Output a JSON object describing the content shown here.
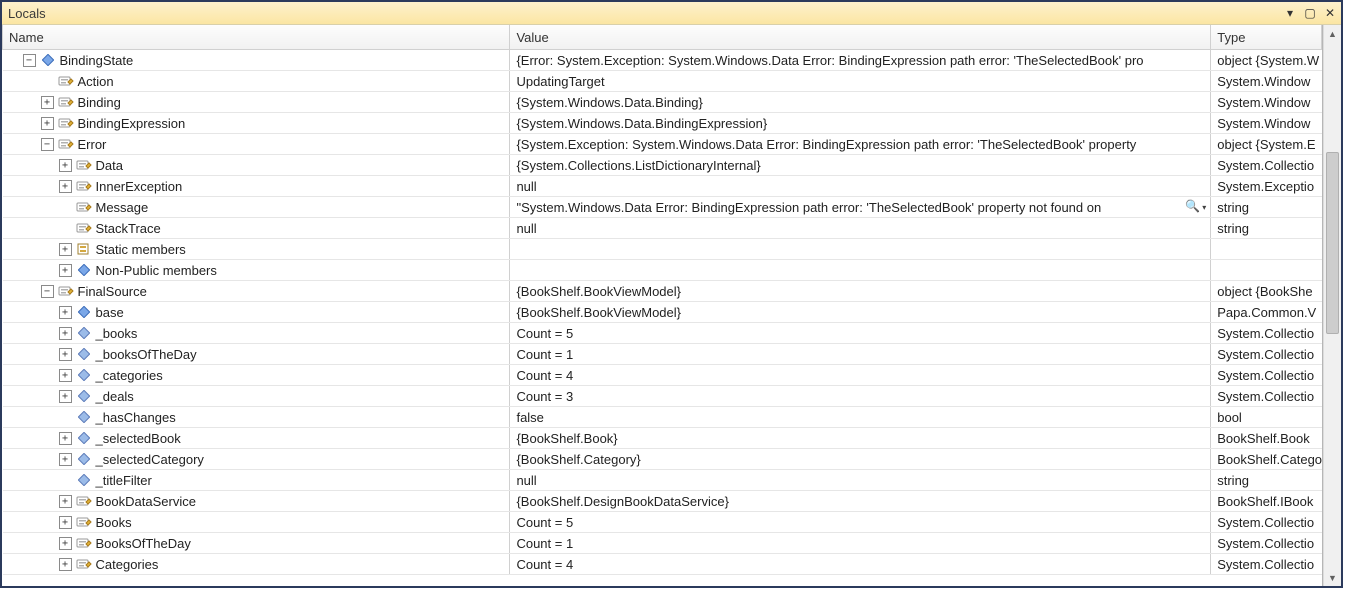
{
  "window": {
    "title": "Locals"
  },
  "columns": {
    "name": "Name",
    "value": "Value",
    "type": "Type"
  },
  "widths": {
    "name": 504,
    "value": 696,
    "type": 110
  },
  "rows": [
    {
      "depth": 0,
      "expander": "minus",
      "icon": "diamond-blue",
      "name": "BindingState",
      "value": "{Error: System.Exception: System.Windows.Data Error: BindingExpression path error: 'TheSelectedBook' pro",
      "type": "object {System.W"
    },
    {
      "depth": 1,
      "expander": "none",
      "icon": "prop",
      "name": "Action",
      "value": "UpdatingTarget",
      "type": "System.Window"
    },
    {
      "depth": 1,
      "expander": "plus",
      "icon": "prop",
      "name": "Binding",
      "value": "{System.Windows.Data.Binding}",
      "type": "System.Window"
    },
    {
      "depth": 1,
      "expander": "plus",
      "icon": "prop",
      "name": "BindingExpression",
      "value": "{System.Windows.Data.BindingExpression}",
      "type": "System.Window"
    },
    {
      "depth": 1,
      "expander": "minus",
      "icon": "prop",
      "name": "Error",
      "value": "{System.Exception: System.Windows.Data Error: BindingExpression path error: 'TheSelectedBook' property",
      "type": "object {System.E"
    },
    {
      "depth": 2,
      "expander": "plus",
      "icon": "prop",
      "name": "Data",
      "value": "{System.Collections.ListDictionaryInternal}",
      "type": "System.Collectio"
    },
    {
      "depth": 2,
      "expander": "plus",
      "icon": "prop",
      "name": "InnerException",
      "value": "null",
      "type": "System.Exceptio"
    },
    {
      "depth": 2,
      "expander": "none",
      "icon": "prop",
      "name": "Message",
      "value": "\"System.Windows.Data Error: BindingExpression path error: 'TheSelectedBook' property not found on",
      "type": "string",
      "hasMagnifier": true
    },
    {
      "depth": 2,
      "expander": "none",
      "icon": "prop",
      "name": "StackTrace",
      "value": "null",
      "type": "string"
    },
    {
      "depth": 2,
      "expander": "plus",
      "icon": "static",
      "name": "Static members",
      "value": "",
      "type": ""
    },
    {
      "depth": 2,
      "expander": "plus",
      "icon": "diamond-blue",
      "name": "Non-Public members",
      "value": "",
      "type": ""
    },
    {
      "depth": 1,
      "expander": "minus",
      "icon": "prop",
      "name": "FinalSource",
      "value": "{BookShelf.BookViewModel}",
      "type": "object {BookShe"
    },
    {
      "depth": 2,
      "expander": "plus",
      "icon": "diamond-blue",
      "name": "base",
      "value": "{BookShelf.BookViewModel}",
      "type": "Papa.Common.V"
    },
    {
      "depth": 2,
      "expander": "plus",
      "icon": "field",
      "name": "_books",
      "value": "Count = 5",
      "type": "System.Collectio"
    },
    {
      "depth": 2,
      "expander": "plus",
      "icon": "field",
      "name": "_booksOfTheDay",
      "value": "Count = 1",
      "type": "System.Collectio"
    },
    {
      "depth": 2,
      "expander": "plus",
      "icon": "field",
      "name": "_categories",
      "value": "Count = 4",
      "type": "System.Collectio"
    },
    {
      "depth": 2,
      "expander": "plus",
      "icon": "field",
      "name": "_deals",
      "value": "Count = 3",
      "type": "System.Collectio"
    },
    {
      "depth": 2,
      "expander": "none",
      "icon": "field",
      "name": "_hasChanges",
      "value": "false",
      "type": "bool"
    },
    {
      "depth": 2,
      "expander": "plus",
      "icon": "field",
      "name": "_selectedBook",
      "value": "{BookShelf.Book}",
      "type": "BookShelf.Book"
    },
    {
      "depth": 2,
      "expander": "plus",
      "icon": "field",
      "name": "_selectedCategory",
      "value": "{BookShelf.Category}",
      "type": "BookShelf.Catego"
    },
    {
      "depth": 2,
      "expander": "none",
      "icon": "field",
      "name": "_titleFilter",
      "value": "null",
      "type": "string"
    },
    {
      "depth": 2,
      "expander": "plus",
      "icon": "prop",
      "name": "BookDataService",
      "value": "{BookShelf.DesignBookDataService}",
      "type": "BookShelf.IBook"
    },
    {
      "depth": 2,
      "expander": "plus",
      "icon": "prop",
      "name": "Books",
      "value": "Count = 5",
      "type": "System.Collectio"
    },
    {
      "depth": 2,
      "expander": "plus",
      "icon": "prop",
      "name": "BooksOfTheDay",
      "value": "Count = 1",
      "type": "System.Collectio"
    },
    {
      "depth": 2,
      "expander": "plus",
      "icon": "prop",
      "name": "Categories",
      "value": "Count = 4",
      "type": "System.Collectio"
    }
  ]
}
